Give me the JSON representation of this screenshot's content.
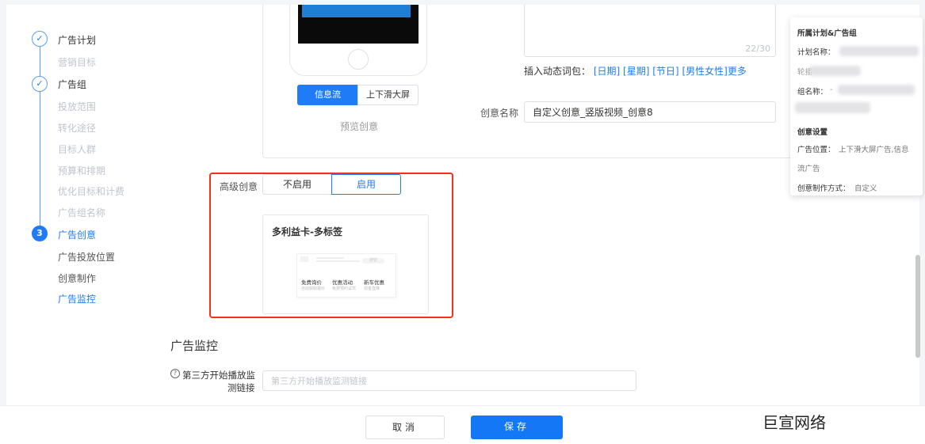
{
  "steps": [
    {
      "label": "广告计划",
      "state": "done"
    },
    {
      "label": "营销目标",
      "state": "sub-done"
    },
    {
      "label": "广告组",
      "state": "done"
    },
    {
      "label": "投放范围",
      "state": "sub-done"
    },
    {
      "label": "转化途径",
      "state": "sub-done"
    },
    {
      "label": "目标人群",
      "state": "sub-done"
    },
    {
      "label": "预算和排期",
      "state": "sub-done"
    },
    {
      "label": "优化目标和计费",
      "state": "sub-done"
    },
    {
      "label": "广告组名称",
      "state": "sub-done"
    },
    {
      "label": "广告创意",
      "state": "active",
      "number": "3"
    },
    {
      "label": "广告投放位置",
      "state": "sub"
    },
    {
      "label": "创意制作",
      "state": "sub"
    },
    {
      "label": "广告监控",
      "state": "sub-active"
    }
  ],
  "preview": {
    "tab_feed": "信息流",
    "tab_vertical": "上下滑大屏",
    "preview_label": "预览创意"
  },
  "title_field": {
    "counter": "22/30",
    "dynamic_label": "插入动态词包：",
    "dynamic_words": [
      "[日期]",
      "[星期]",
      "[节日]",
      "[男性女性]"
    ],
    "more": "更多"
  },
  "creative_name": {
    "label": "创意名称",
    "value": "自定义创意_竖版视频_创意8"
  },
  "advanced": {
    "label": "高级创意",
    "off": "不启用",
    "on": "启用",
    "card_title": "多利益卡-多标签",
    "card_items": [
      {
        "t": "免费询价",
        "s": "自动获取报价"
      },
      {
        "t": "优惠活动",
        "s": "免费预约试驾"
      },
      {
        "t": "新车优惠",
        "s": "现金直降"
      }
    ],
    "mini_btn": "按钮"
  },
  "monitor": {
    "section_title": "广告监控",
    "field_label_1": "第三方开始播放监",
    "field_label_2": "测链接",
    "placeholder": "第三方开始播放监测链接"
  },
  "footer": {
    "cancel": "取消",
    "save": "保存"
  },
  "watermark": "巨宣网络",
  "summary": {
    "title": "所属计划&广告组",
    "plan_name": "计划名称：",
    "plan_name_prefix": "轮播",
    "group_name": "组名称：",
    "group_dash": "-",
    "creative_settings": "创意设置",
    "placement_label": "广告位置：",
    "placement_value": "上下滑大屏广告,信息",
    "placement_value_2": "流广告",
    "method_label": "创意制作方式：",
    "method_value": "自定义"
  },
  "colors": {
    "primary": "#1f7cf6",
    "highlight": "#f0321e"
  }
}
